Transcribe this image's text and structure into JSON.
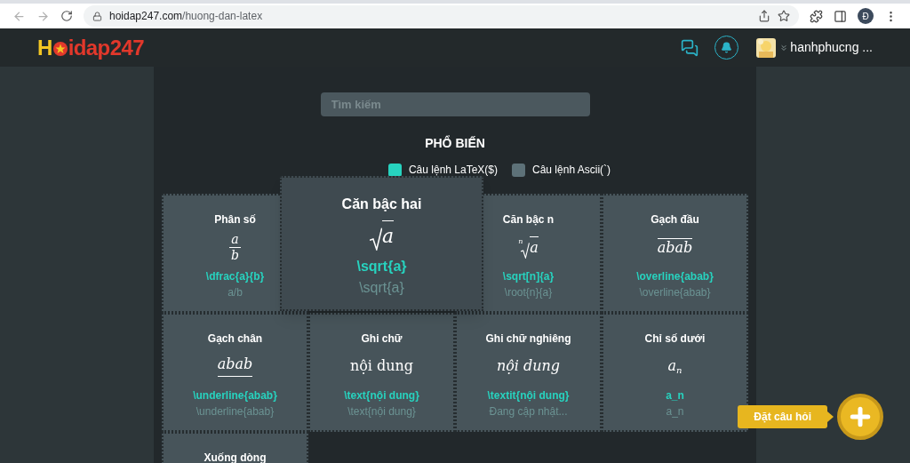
{
  "browser": {
    "url_host": "hoidap247.com",
    "url_path": "/huong-dan-latex",
    "profile_initial": "Đ"
  },
  "header": {
    "logo_first": "H",
    "logo_rest": "idap247",
    "username": "hanhphucng ..."
  },
  "search": {
    "placeholder": "Tìm kiếm"
  },
  "section_title": "PHỔ BIẾN",
  "modes": [
    {
      "label": "Câu lệnh LaTeX($)",
      "checked": true
    },
    {
      "label": "Câu lệnh Ascii(`)",
      "checked": false
    }
  ],
  "featured": {
    "title": "Căn bậc hai",
    "preview": {
      "kind": "sqrt",
      "body": "a"
    },
    "latex": "\\sqrt{a}",
    "ascii": "\\sqrt{a}"
  },
  "cards": [
    {
      "title": "Phân số",
      "preview": {
        "kind": "fraction",
        "top": "a",
        "bottom": "b"
      },
      "latex": "\\dfrac{a}{b}",
      "ascii": "a/b"
    },
    {
      "kind": "hidden"
    },
    {
      "title": "Căn bậc n",
      "preview": {
        "kind": "root",
        "index": "n",
        "body": "a"
      },
      "latex": "\\sqrt[n]{a}",
      "ascii": "\\root{n}{a}"
    },
    {
      "title": "Gạch đầu",
      "preview": {
        "kind": "overline",
        "body": "abab"
      },
      "latex": "\\overline{abab}",
      "ascii": "\\overline{abab}"
    },
    {
      "title": "Gạch chân",
      "preview": {
        "kind": "underline",
        "body": "abab"
      },
      "latex": "\\underline{abab}",
      "ascii": "\\underline{abab}"
    },
    {
      "title": "Ghi chữ",
      "preview": {
        "kind": "text",
        "body": "nội dung"
      },
      "latex": "\\text{nội dung}",
      "ascii": "\\text{nội dung}"
    },
    {
      "title": "Ghi chữ nghiêng",
      "preview": {
        "kind": "italic",
        "body": "nội dung"
      },
      "latex": "\\textit{nội dung}",
      "ascii": "Đang cập nhật..."
    },
    {
      "title": "Chỉ số dưới",
      "preview": {
        "kind": "subscript",
        "body": "a",
        "sub": "n"
      },
      "latex": "a_n",
      "ascii": "a_n"
    },
    {
      "title": "Xuống dòng"
    }
  ],
  "ask": {
    "label": "Đặt câu hỏi"
  }
}
